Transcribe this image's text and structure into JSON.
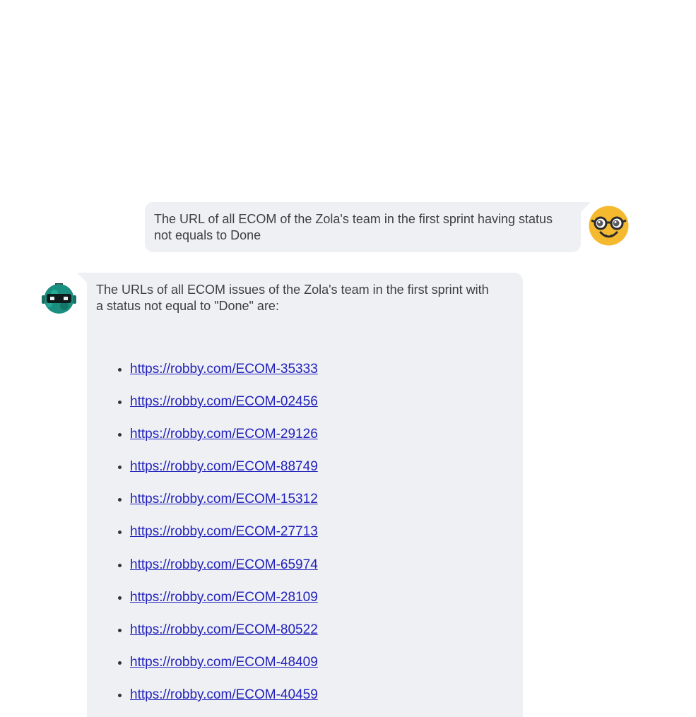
{
  "user_message": {
    "text": "The URL of all ECOM of the Zola's team in the first sprint having status not equals to Done",
    "avatar_icon": "nerd-face-emoji-icon"
  },
  "bot_message": {
    "avatar_icon": "robot-avatar-icon",
    "intro": "The URLs of all ECOM issues of the Zola's team in the first sprint with a status not equal to \"Done\" are:",
    "links": [
      "https://robby.com/ECOM-35333",
      "https://robby.com/ECOM-02456",
      "https://robby.com/ECOM-29126",
      "https://robby.com/ECOM-88749",
      "https://robby.com/ECOM-15312",
      "https://robby.com/ECOM-27713",
      "https://robby.com/ECOM-65974",
      "https://robby.com/ECOM-28109",
      "https://robby.com/ECOM-80522",
      "https://robby.com/ECOM-48409",
      "https://robby.com/ECOM-40459"
    ]
  },
  "colors": {
    "bubble_bg": "#eff0f4",
    "link": "#2222bb",
    "avatar_user": "#f5b930",
    "avatar_bot": "#1a8f80"
  }
}
